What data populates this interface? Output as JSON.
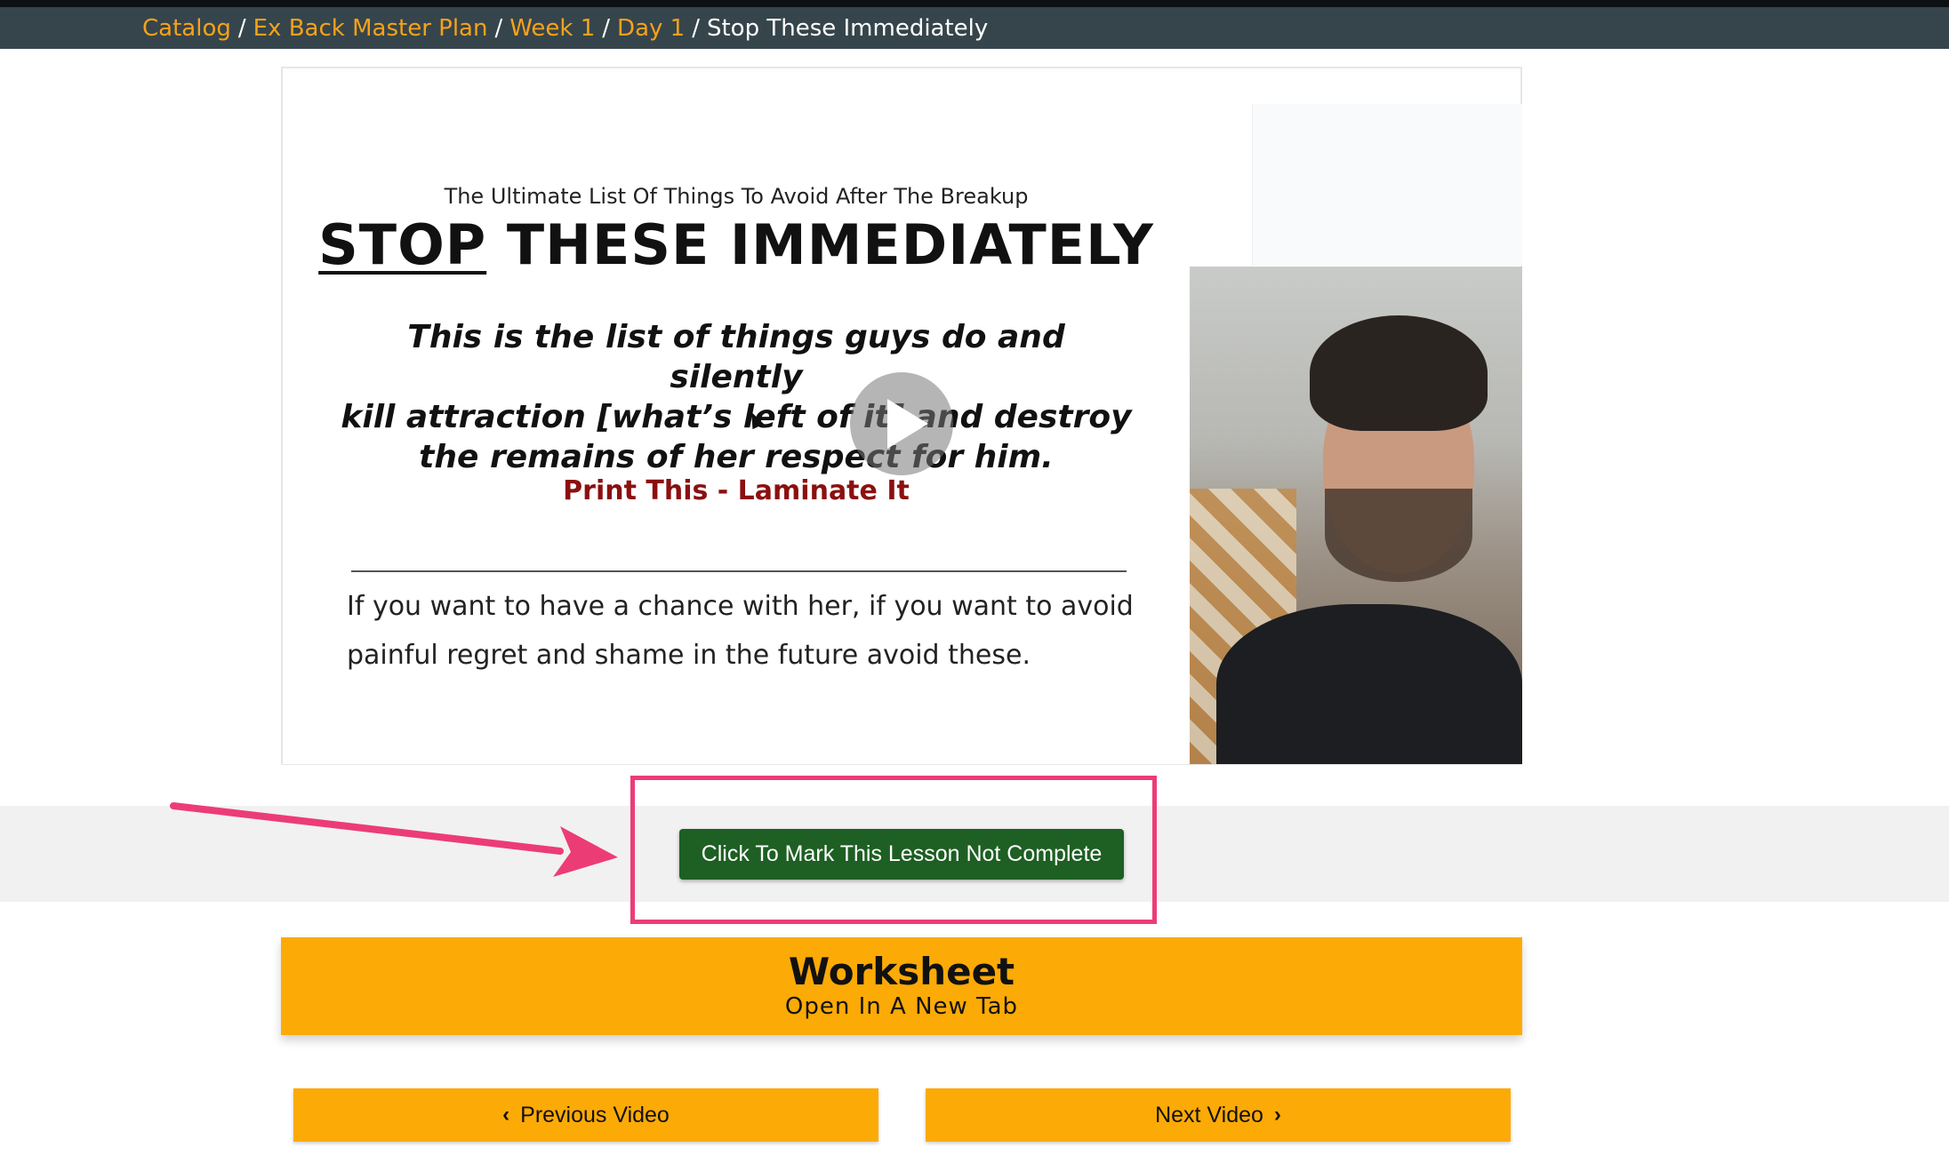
{
  "breadcrumb": {
    "items": [
      "Catalog",
      "Ex Back Master Plan",
      "Week 1",
      "Day 1"
    ],
    "separator": "/",
    "current": "Stop These Immediately"
  },
  "slide": {
    "pre_title": "The Ultimate List Of Things To Avoid After The Breakup",
    "title_underlined": "STOP",
    "title_rest": "THESE IMMEDIATELY",
    "body_lines": [
      "This is the list of things guys do and silently",
      "kill attraction [what’s left of it] and destroy",
      "the remains of her respect for him."
    ],
    "cta": "Print This - Laminate It",
    "description_lines": [
      "If you want to have a chance with her, if you want to avoid",
      "painful regret and shame in the future avoid these."
    ]
  },
  "video": {
    "play_icon": "play-icon"
  },
  "lesson": {
    "complete_button_label": "Click To Mark This Lesson Not Complete"
  },
  "worksheet": {
    "title": "Worksheet",
    "subtitle": "Open In A New Tab"
  },
  "nav": {
    "prev_label": "Previous Video",
    "next_label": "Next Video",
    "prev_icon": "chevron-left-icon",
    "next_icon": "chevron-right-icon"
  },
  "colors": {
    "breadcrumb_link": "#f7a21a",
    "header_bar": "#36454b",
    "complete_button": "#1e5f23",
    "worksheet_bg": "#fcaa06",
    "annotation": "#ec3c76",
    "cta_text": "#8b1010"
  }
}
